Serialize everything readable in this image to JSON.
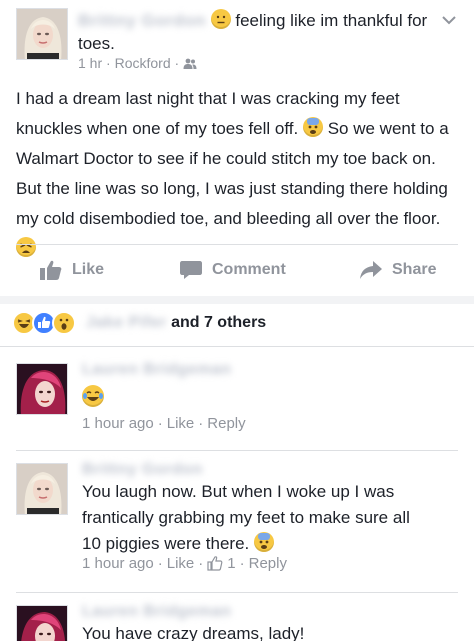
{
  "post": {
    "author": "Brittny Gordon",
    "feeling": "feeling like im thankful",
    "feeling_object": "for toes.",
    "time": "1 hr",
    "location": "Rockford",
    "body_part1": "I had a dream last night that I was cracking my feet knuckles when one of my toes fell off.",
    "body_part2": "So we went to a Walmart Doctor to see if he could stitch my toe back on. But the line was so long, I was just standing there holding my cold disembodied toe, and bleeding all over the floor."
  },
  "actions": {
    "like": "Like",
    "comment": "Comment",
    "share": "Share"
  },
  "reactions": {
    "name": "Jake Pifer",
    "others": "and 7 others"
  },
  "comments": [
    {
      "author": "Lauren Bridgeman",
      "text": "",
      "time": "1 hour ago",
      "like": "Like",
      "reply": "Reply",
      "like_count": ""
    },
    {
      "author": "Brittny Gordon",
      "text": "You laugh now. But when I woke up I was frantically grabbing my feet to make sure all 10 piggies were there.",
      "time": "1 hour ago",
      "like": "Like",
      "reply": "Reply",
      "like_count": "1"
    },
    {
      "author": "Lauren Bridgeman",
      "text": "You have crazy dreams, lady!"
    }
  ],
  "separator": "·",
  "colors": {
    "meta": "#90949c",
    "divider": "#dddfe2",
    "like_blue": "#4080ff",
    "emoji_yellow": "#f7c843"
  }
}
